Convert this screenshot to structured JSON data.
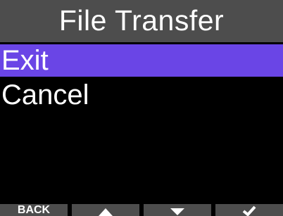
{
  "colors": {
    "background": "#000000",
    "title_bar": "#4d4d4d",
    "selected_item": "#6a45e6",
    "text": "#ffffff",
    "softkey_bg": "#4d4d4d"
  },
  "header": {
    "title": "File Transfer"
  },
  "menu": {
    "items": [
      {
        "label": "Exit",
        "selected": true
      },
      {
        "label": "Cancel",
        "selected": false
      }
    ]
  },
  "softkeys": {
    "back_label": "BACK",
    "up_icon": "triangle-up-icon",
    "down_icon": "triangle-down-icon",
    "confirm_icon": "checkmark-icon"
  }
}
